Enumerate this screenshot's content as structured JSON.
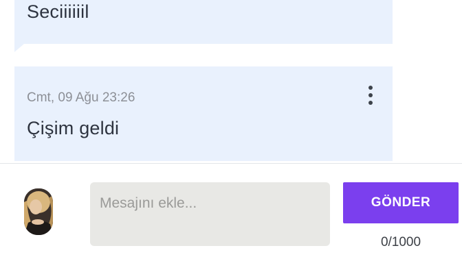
{
  "messages": [
    {
      "text": "Seciiiiiil"
    },
    {
      "timestamp": "Cmt, 09 Ağu 23:26",
      "text": "Çişim geldi",
      "menu_icon": "more-vertical-icon"
    }
  ],
  "composer": {
    "avatar": "user-avatar",
    "placeholder": "Mesajını ekle...",
    "send_label": "GÖNDER",
    "counter": "0/1000"
  },
  "colors": {
    "bubble_bg": "#e9f1fd",
    "accent": "#7b3fee",
    "input_bg": "#e8e8e5",
    "text_primary": "#2e3440",
    "text_muted": "#8c8f96"
  }
}
